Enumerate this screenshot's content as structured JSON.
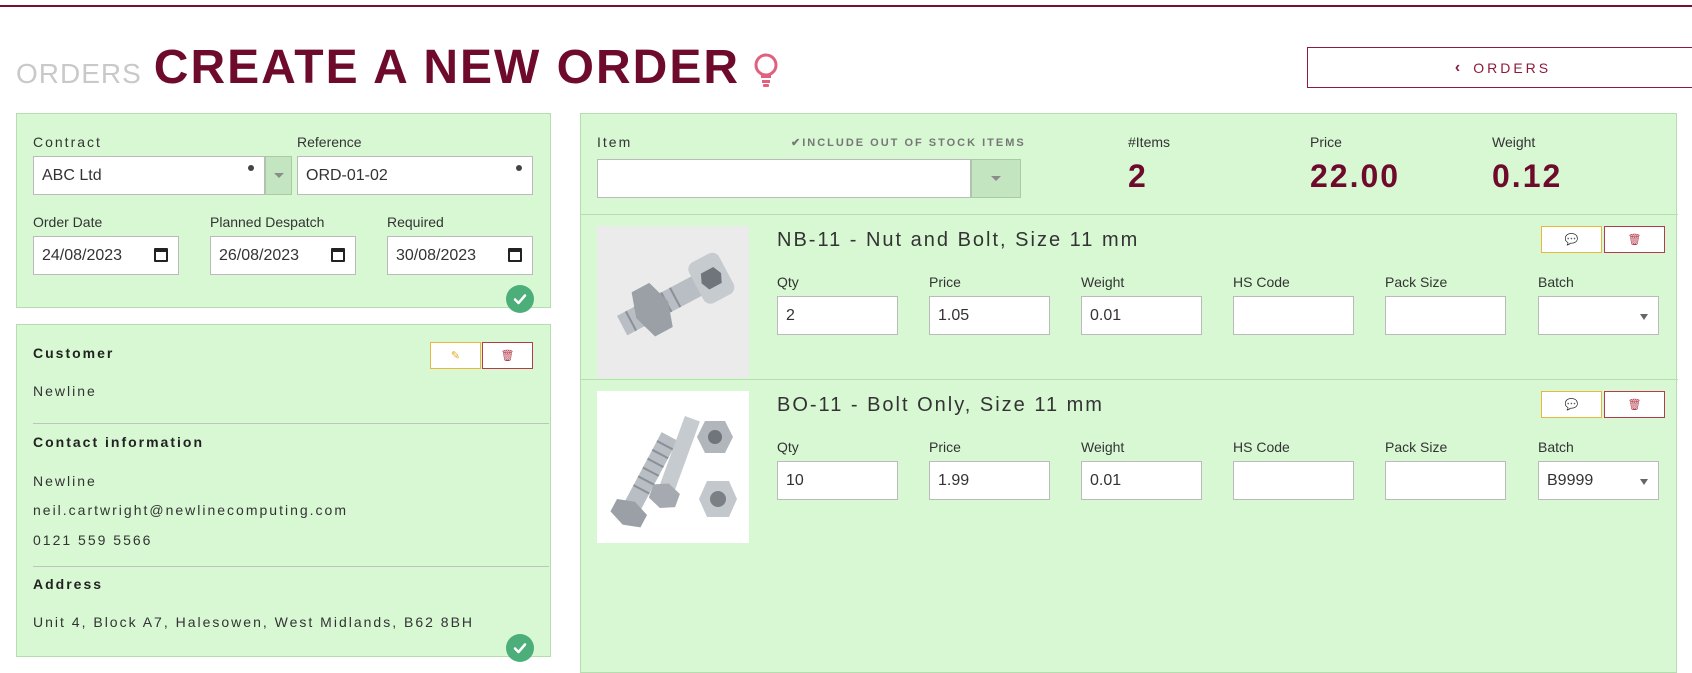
{
  "header": {
    "breadcrumb": "ORDERS",
    "title": "CREATE A NEW ORDER",
    "back_button": "ORDERS"
  },
  "order": {
    "contract_label": "Contract",
    "contract_value": "ABC Ltd",
    "reference_label": "Reference",
    "reference_value": "ORD-01-02",
    "order_date_label": "Order Date",
    "order_date_value": "24/08/2023",
    "despatch_label": "Planned Despatch",
    "despatch_value": "26/08/2023",
    "required_label": "Required",
    "required_value": "30/08/2023"
  },
  "customer": {
    "customer_title": "Customer",
    "customer_name": "Newline",
    "contact_title": "Contact information",
    "contact_name": "Newline",
    "contact_email": "neil.cartwright@newlinecomputing.com",
    "contact_phone": "0121 559 5566",
    "address_title": "Address",
    "address": "Unit 4, Block A7, Halesowen, West Midlands, B62 8BH"
  },
  "items_panel": {
    "item_label": "Item",
    "include_label": "INCLUDE OUT OF STOCK ITEMS",
    "count_label": "#Items",
    "count_value": "2",
    "price_label": "Price",
    "price_value": "22.00",
    "weight_label": "Weight",
    "weight_value": "0.12"
  },
  "columns": {
    "qty": "Qty",
    "price": "Price",
    "weight": "Weight",
    "hs_code": "HS Code",
    "pack_size": "Pack Size",
    "batch": "Batch"
  },
  "lines": [
    {
      "name": "NB-11 - Nut and Bolt, Size 11 mm",
      "qty": "2",
      "price": "1.05",
      "weight": "0.01",
      "hs_code": "",
      "pack_size": "",
      "batch": ""
    },
    {
      "name": "BO-11 - Bolt Only, Size 11 mm",
      "qty": "10",
      "price": "1.99",
      "weight": "0.01",
      "hs_code": "",
      "pack_size": "",
      "batch": "B9999"
    }
  ],
  "colors": {
    "accent": "#6e0a2c",
    "panel_bg": "#d8f8d4",
    "success": "#4caf7a"
  }
}
